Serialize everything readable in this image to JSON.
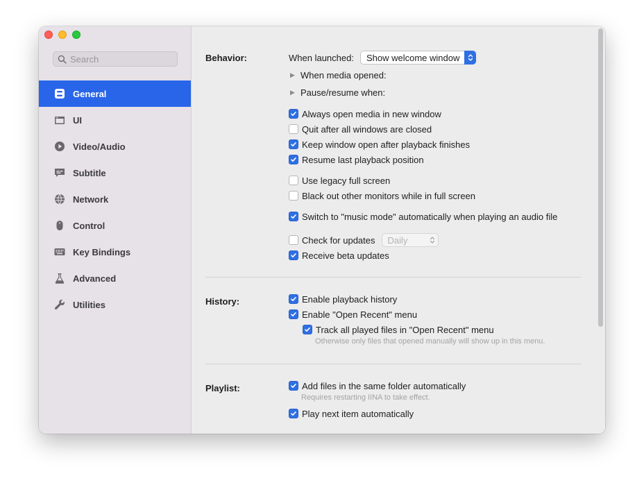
{
  "window": {
    "traffic_lights": {
      "close": "#fe5f57",
      "minimize": "#febc2e",
      "maximize": "#28c840"
    }
  },
  "sidebar": {
    "search": {
      "placeholder": "Search",
      "value": ""
    },
    "items": [
      {
        "label": "General",
        "icon": "general-icon",
        "active": true
      },
      {
        "label": "UI",
        "icon": "window-icon",
        "active": false
      },
      {
        "label": "Video/Audio",
        "icon": "play-icon",
        "active": false
      },
      {
        "label": "Subtitle",
        "icon": "subtitle-icon",
        "active": false
      },
      {
        "label": "Network",
        "icon": "globe-icon",
        "active": false
      },
      {
        "label": "Control",
        "icon": "mouse-icon",
        "active": false
      },
      {
        "label": "Key Bindings",
        "icon": "keyboard-icon",
        "active": false
      },
      {
        "label": "Advanced",
        "icon": "flask-icon",
        "active": false
      },
      {
        "label": "Utilities",
        "icon": "wrench-icon",
        "active": false
      }
    ],
    "accent": "#2865e8"
  },
  "behavior": {
    "label": "Behavior:",
    "when_launched_label": "When launched:",
    "when_launched_value": "Show welcome window",
    "when_media_opened": "When media opened:",
    "pause_resume_when": "Pause/resume when:",
    "always_open_new_window": {
      "label": "Always open media in new window",
      "checked": true
    },
    "quit_after_windows_closed": {
      "label": "Quit after all windows are closed",
      "checked": false
    },
    "keep_window_open": {
      "label": "Keep window open after playback finishes",
      "checked": true
    },
    "resume_last_position": {
      "label": "Resume last playback position",
      "checked": true
    },
    "legacy_full_screen": {
      "label": "Use legacy full screen",
      "checked": false
    },
    "black_out_monitors": {
      "label": "Black out other monitors while in full screen",
      "checked": false
    },
    "music_mode": {
      "label": "Switch to \"music mode\" automatically when playing an audio file",
      "checked": true
    },
    "check_updates": {
      "label": "Check for updates",
      "checked": false
    },
    "check_updates_frequency": "Daily",
    "receive_beta": {
      "label": "Receive beta updates",
      "checked": true
    }
  },
  "history": {
    "label": "History:",
    "enable_history": {
      "label": "Enable playback history",
      "checked": true
    },
    "enable_open_recent": {
      "label": "Enable \"Open Recent\" menu",
      "checked": true
    },
    "track_all_played": {
      "label": "Track all played files in \"Open Recent\" menu",
      "checked": true
    },
    "track_hint": "Otherwise only files that opened manually will show up in this menu."
  },
  "playlist": {
    "label": "Playlist:",
    "add_same_folder": {
      "label": "Add files in the same folder automatically",
      "checked": true
    },
    "add_hint": "Requires restarting IINA to take effect.",
    "play_next": {
      "label": "Play next item automatically",
      "checked": true
    }
  }
}
